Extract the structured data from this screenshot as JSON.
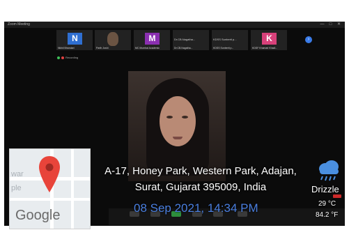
{
  "window": {
    "title": "Zoom Meeting"
  },
  "participants": [
    {
      "initial": "N",
      "name": "Nikhil Bhandari",
      "color": "#2f6fd1"
    },
    {
      "initial": "",
      "name": "Parth Joshi",
      "color": "#3a3a3a"
    },
    {
      "initial": "M",
      "name": "MC Mumbai Academic",
      "color": "#8a2fb0"
    },
    {
      "initial": "",
      "name": "Dr.CB.Nagatha...",
      "label": "Dr.CB.Nagatha...",
      "color": "#222222"
    },
    {
      "initial": "",
      "name": "KDSS Sunberti p...",
      "label": "KDSS Sunberti p...",
      "color": "#222222"
    },
    {
      "initial": "K",
      "name": "KDSF Khamari Khadi...",
      "color": "#d8417a"
    }
  ],
  "recording": {
    "label": "Recording"
  },
  "location": {
    "line1": "A-17, Honey Park, Western Park, Adajan,",
    "line2": "Surat, Gujarat 395009, India"
  },
  "timestamp": "08 Sep 2021, 14:34 PM",
  "weather": {
    "condition": "Drizzle",
    "temp_c": "29 °C",
    "temp_f": "84.2 °F"
  },
  "map": {
    "brand": "Google",
    "fragment1": "war",
    "fragment2": "ple"
  },
  "colors": {
    "accent": "#4a7fe0",
    "next_button": "#3a7be8"
  }
}
